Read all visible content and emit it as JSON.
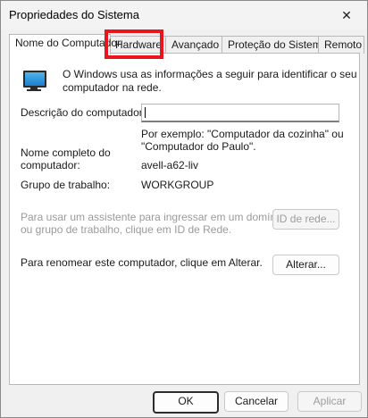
{
  "window": {
    "title": "Propriedades do Sistema",
    "close_glyph": "✕"
  },
  "tabs": [
    {
      "label": "Nome do Computador"
    },
    {
      "label": "Hardware"
    },
    {
      "label": "Avançado"
    },
    {
      "label": "Proteção do Sistema"
    },
    {
      "label": "Remoto"
    }
  ],
  "panel": {
    "info_line1": "O Windows usa as informações a seguir para identificar o seu",
    "info_line2": "computador na rede.",
    "description_label": "Descrição do computador:",
    "description_value": "",
    "example_line1": "Por exemplo: \"Computador da cozinha\" ou",
    "example_line2": "\"Computador do Paulo\".",
    "fullname_label_line1": "Nome completo do",
    "fullname_label_line2": "computador:",
    "fullname_value": "avell-a62-liv",
    "workgroup_label": "Grupo de trabalho:",
    "workgroup_value": "WORKGROUP",
    "network_text_line1": "Para usar um assistente para ingressar em um domínio",
    "network_text_line2": "ou grupo de trabalho, clique em ID de Rede.",
    "network_id_button": "ID de rede...",
    "rename_text": "Para renomear este computador, clique em Alterar.",
    "change_button": "Alterar..."
  },
  "footer": {
    "ok": "OK",
    "cancel": "Cancelar",
    "apply": "Aplicar"
  },
  "highlight_color": "#e8141e"
}
